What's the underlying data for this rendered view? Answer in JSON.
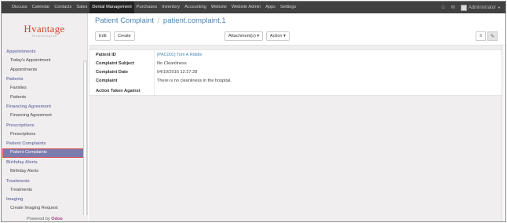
{
  "topnav": {
    "items": [
      {
        "label": "Discuss"
      },
      {
        "label": "Calendar"
      },
      {
        "label": "Contacts"
      },
      {
        "label": "Sales"
      },
      {
        "label": "Dental Management"
      },
      {
        "label": "Purchases"
      },
      {
        "label": "Inventory"
      },
      {
        "label": "Accounting"
      },
      {
        "label": "Website"
      },
      {
        "label": "Website Admin"
      },
      {
        "label": "Apps"
      },
      {
        "label": "Settings"
      }
    ],
    "active_index": 4,
    "user": "Administrator"
  },
  "logo": {
    "brand": "Hvantage",
    "sub": "Technologies"
  },
  "sidebar": {
    "sections": [
      {
        "title": "Appointments",
        "items": [
          "Today's Appointment",
          "Appointments"
        ]
      },
      {
        "title": "Patients",
        "items": [
          "Families",
          "Patients"
        ]
      },
      {
        "title": "Financing Agreement",
        "items": [
          "Financing Agreement"
        ]
      },
      {
        "title": "Prescriptions",
        "items": [
          "Prescriptions"
        ]
      },
      {
        "title": "Patient Complaints",
        "items": [
          "Patient Complaints"
        ]
      },
      {
        "title": "Birthday Alerts",
        "items": [
          "Birthday Alerts"
        ]
      },
      {
        "title": "Treatments",
        "items": [
          "Treatments"
        ]
      },
      {
        "title": "Imaging",
        "items": [
          "Create Imaging Request"
        ]
      }
    ],
    "powered_prefix": "Powered by",
    "powered_brand": "Odoo"
  },
  "breadcrumb": {
    "parent": "Patient Complaint",
    "separator": "/",
    "current": "patient.complaint,1"
  },
  "toolbar": {
    "edit_label": "Edit",
    "create_label": "Create",
    "attachments_label": "Attachment(s) ▾",
    "action_label": "Action ▾"
  },
  "form": {
    "fields": [
      {
        "label": "Patient ID",
        "value": "[PAC001] Tom A Riddle",
        "link": true
      },
      {
        "label": "Complaint Subject",
        "value": "No Cleanliness",
        "link": false
      },
      {
        "label": "Complaint Date",
        "value": "04/19/2016 12:27:28",
        "link": false
      },
      {
        "label": "Complaint",
        "value": "There is no cleanliness in the hospital.",
        "link": false
      },
      {
        "label": "Action Taken Against",
        "value": "",
        "link": false
      }
    ]
  },
  "icons": {
    "chat": "chat-icon",
    "messages": "messages-icon",
    "list_view": "list-view-icon",
    "form_view": "form-view-icon"
  },
  "colors": {
    "topbar": "#414141",
    "sidebar_section": "#7c7bad",
    "link": "#4c86b9",
    "active_highlight": "#d9534f",
    "odoo": "#a24689"
  }
}
